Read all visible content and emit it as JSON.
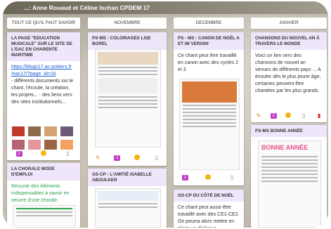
{
  "title": "...: Anne Rouaud et Céline Ischan CPDEM 17",
  "columns": [
    {
      "label": "TOUT CE QU'IL FAUT SAVOIR"
    },
    {
      "label": "NOVEMBRE"
    },
    {
      "label": "DECEMBRE"
    },
    {
      "label": "JANVIER"
    }
  ],
  "cards": {
    "c1": {
      "title": "LA PAGE \"EDUCATION MUSICALE\" SUR LE SITE DE L'EAC EN CHARENTE MARITIME",
      "link": "https://blogs17.ac-poitiers.fr /eac17/?page_id=16",
      "text": "- différents documents sur le chant, l'écoute, la création, les projets... - des liens vers des sites institutionnels..."
    },
    "c2": {
      "title": "LA CHORALE MODE D'EMPLOI",
      "text": "Résumé des éléments indispensables à savoir en oeuvre d'une chorale."
    },
    "c3": {
      "title": "PS-MS : COLORIAGES LISE BOREL"
    },
    "c4": {
      "title": "GS-CP : L'AMITIÉ ISABELLE ABOULKER"
    },
    "c5": {
      "title": "PS - MS : CANON DE NOËL A ET IM VERSINI",
      "text": "Ce chant peut être travaillé en canon avec des cycles 2 et 3"
    },
    "c6": {
      "title": "GS-CP DU CÔTÉ DE NOËL",
      "text": "Ce chant peut aussi être travaillé avec des CE1-CE2. On pourra alors mettre en place un dialogue"
    },
    "c7": {
      "title": "CHANSONS DU NOUVEL AN À TRAVERS LE MONDE",
      "text": "Voici un lien vers des chansons de nouvel an venues de différents pays ... A écouter dès le plus jeune âge, certaines peuvent être chantées par les plus grands."
    },
    "c8": {
      "title": "PS-MS BONNE ANNÉE",
      "image_text": "BONNE ANNÉE"
    }
  },
  "icons": {
    "edit": "pencil-icon",
    "comment": "comment-badge-icon",
    "react": "circle-icon",
    "doc": "document-icon",
    "delete": "trash-icon"
  },
  "colors": {
    "card_title_bg": "#efe6fb",
    "link": "#1e5fd6",
    "green_text": "#2da44e",
    "accent_badge": "#c23bbf",
    "pencil": "#e07b1a",
    "dot": "#f2b611"
  }
}
